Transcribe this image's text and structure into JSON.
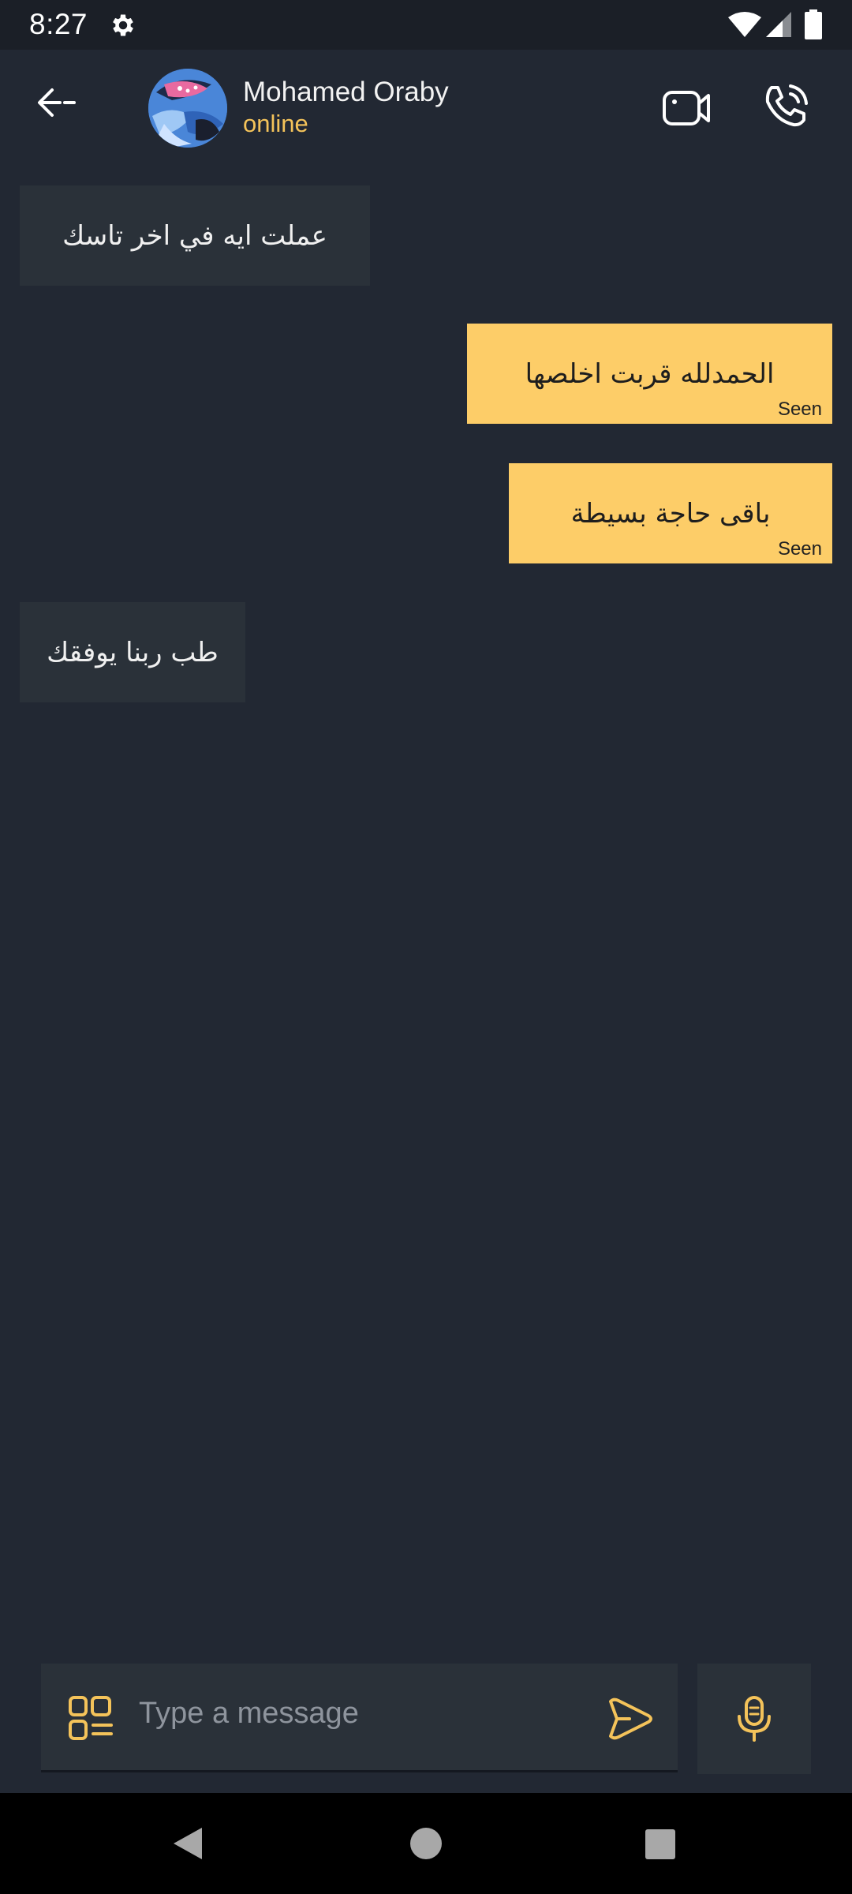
{
  "status_bar": {
    "time": "8:27",
    "icons": [
      "gear-icon",
      "wifi-icon",
      "signal-icon",
      "battery-icon"
    ]
  },
  "header": {
    "back_label": "<-",
    "contact_name": "Mohamed Oraby",
    "contact_status": "online",
    "actions": [
      "video-call-icon",
      "voice-call-icon"
    ]
  },
  "messages": [
    {
      "direction": "incoming",
      "text": "عملت ايه في اخر تاسك"
    },
    {
      "direction": "outgoing",
      "text": "الحمدلله قربت اخلصها",
      "receipt": "Seen"
    },
    {
      "direction": "outgoing",
      "text": "باقى حاجة بسيطة",
      "receipt": "Seen"
    },
    {
      "direction": "incoming",
      "text": "طب ربنا يوفقك"
    }
  ],
  "composer": {
    "placeholder": "Type a message",
    "value": ""
  },
  "colors": {
    "background": "#222833",
    "incoming_bubble": "#2a3139",
    "outgoing_bubble": "#fdcd68",
    "accent": "#f4c35a",
    "status_online": "#f4c35a"
  }
}
